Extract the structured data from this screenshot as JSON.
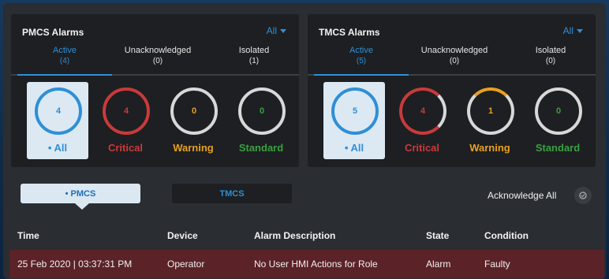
{
  "colors": {
    "accent_blue": "#2f8fd6",
    "critical_red": "#c93a3a",
    "warning_orange": "#e8a020",
    "standard_green": "#3aa040",
    "alarm_row": "#5b2227"
  },
  "pmcs_panel": {
    "title": "PMCS Alarms",
    "filter": "All",
    "tabs": [
      {
        "label": "Active",
        "count": "(4)"
      },
      {
        "label": "Unacknowledged",
        "count": "(0)"
      },
      {
        "label": "Isolated",
        "count": "(1)"
      }
    ],
    "tiles": [
      {
        "value": "4",
        "label": "• All"
      },
      {
        "value": "4",
        "label": "Critical"
      },
      {
        "value": "0",
        "label": "Warning"
      },
      {
        "value": "0",
        "label": "Standard"
      }
    ]
  },
  "tmcs_panel": {
    "title": "TMCS Alarms",
    "filter": "All",
    "tabs": [
      {
        "label": "Active",
        "count": "(5)"
      },
      {
        "label": "Unacknowledged",
        "count": "(0)"
      },
      {
        "label": "Isolated",
        "count": "(0)"
      }
    ],
    "tiles": [
      {
        "value": "5",
        "label": "• All"
      },
      {
        "value": "4",
        "label": "Critical"
      },
      {
        "value": "1",
        "label": "Warning"
      },
      {
        "value": "0",
        "label": "Standard"
      }
    ]
  },
  "system_toggle": {
    "pmcs": "• PMCS",
    "tmcs": "TMCS",
    "selected": "pmcs"
  },
  "acknowledge_all": {
    "label": "Acknowledge All",
    "icon": "acknowledge-icon"
  },
  "table": {
    "columns": [
      "Time",
      "Device",
      "Alarm Description",
      "State",
      "Condition"
    ],
    "rows": [
      {
        "time": "25 Feb 2020 | 03:37:31 PM",
        "device": "Operator",
        "description": "No User HMI Actions for Role",
        "state": "Alarm",
        "condition": "Faulty"
      }
    ]
  }
}
